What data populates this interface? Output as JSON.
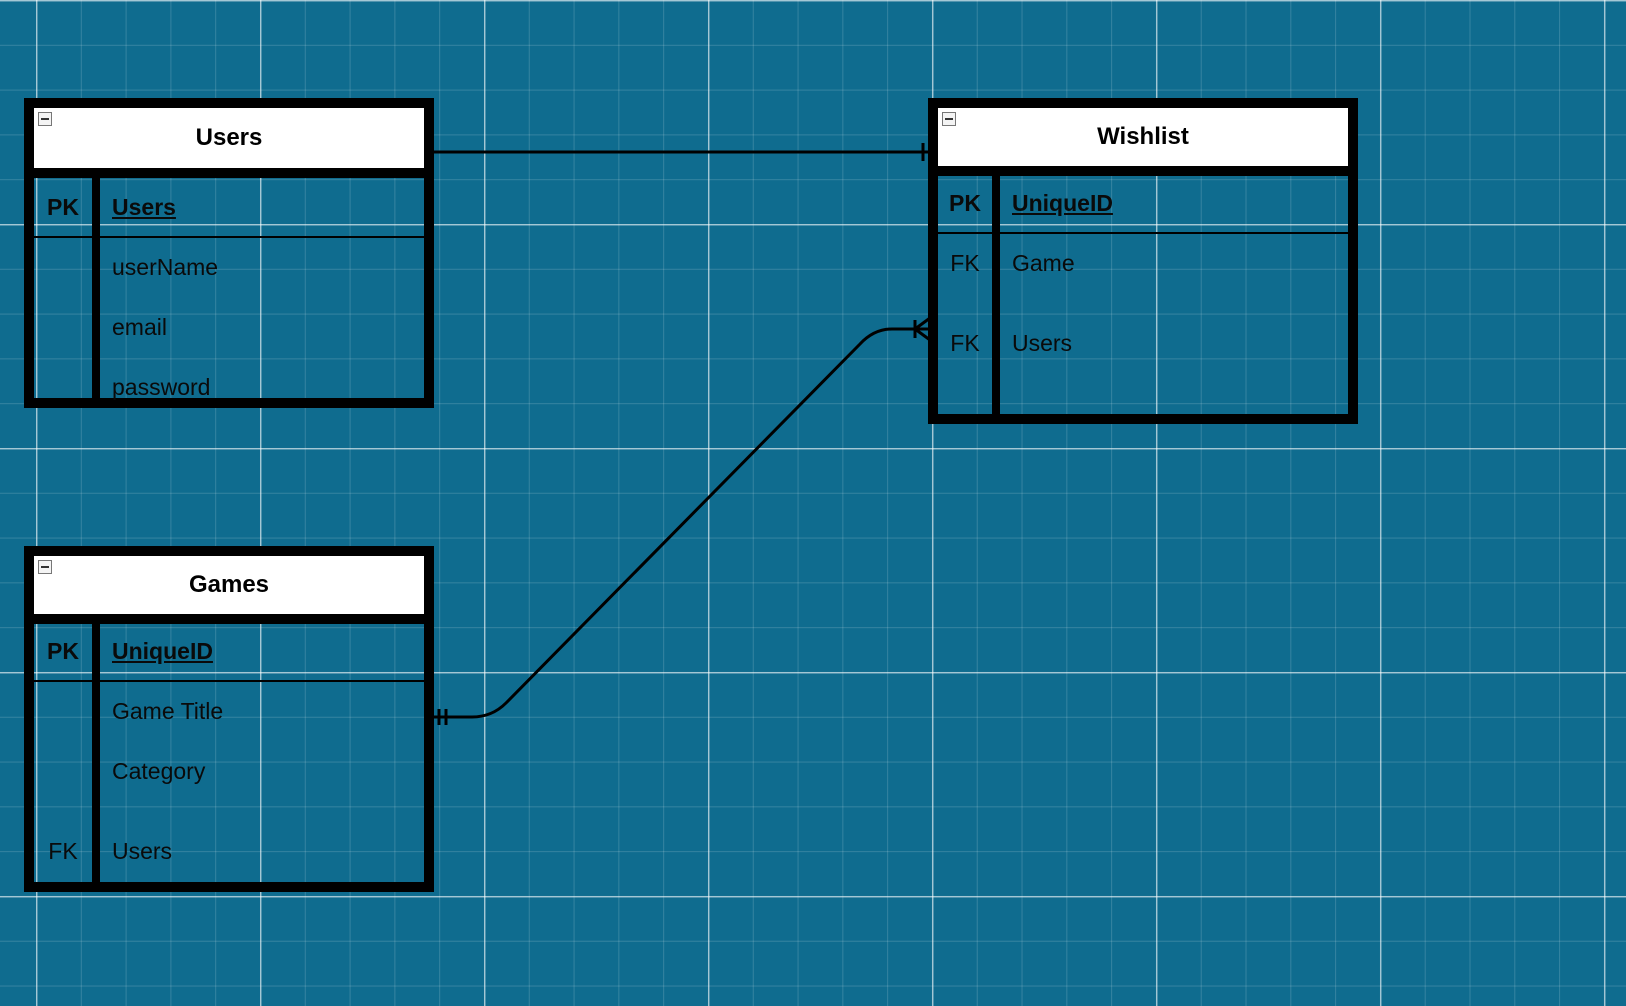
{
  "entities": {
    "users": {
      "title": "Users",
      "pk": {
        "key": "PK",
        "field": "Users"
      },
      "fields": [
        {
          "key": "",
          "field": "userName"
        },
        {
          "key": "",
          "field": "email"
        },
        {
          "key": "",
          "field": "password"
        }
      ]
    },
    "wishlist": {
      "title": "Wishlist",
      "pk": {
        "key": "PK",
        "field": "UniqueID"
      },
      "fields": [
        {
          "key": "FK",
          "field": "Game"
        },
        {
          "key": "FK",
          "field": "Users"
        }
      ]
    },
    "games": {
      "title": "Games",
      "pk": {
        "key": "PK",
        "field": "UniqueID"
      },
      "fields": [
        {
          "key": "",
          "field": "Game Title"
        },
        {
          "key": "",
          "field": "Category"
        },
        {
          "key": "FK",
          "field": "Users"
        }
      ]
    }
  },
  "relationships": [
    {
      "from": "Users",
      "to": "Wishlist",
      "from_cardinality": "none",
      "to_cardinality": "mandatory-one"
    },
    {
      "from": "Games",
      "to": "Wishlist",
      "from_cardinality": "mandatory-one",
      "to_cardinality": "one-or-many"
    }
  ],
  "colors": {
    "canvas": "#0f6c8f",
    "grid": "#ffffff",
    "stroke": "#000000",
    "header_fill": "#ffffff"
  }
}
